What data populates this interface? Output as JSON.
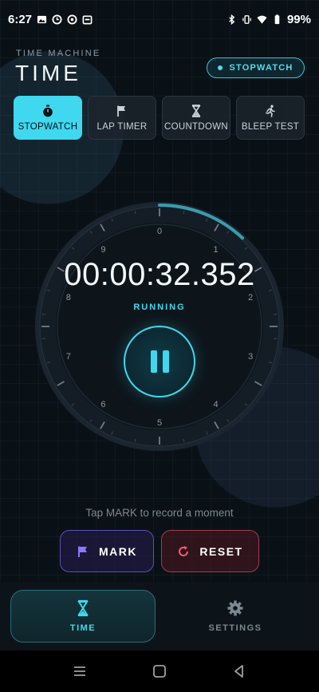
{
  "status_bar": {
    "time": "6:27",
    "battery": "99%"
  },
  "header": {
    "app_name": "TIME MACHINE",
    "title": "TIME",
    "mode_pill": "STOPWATCH"
  },
  "tabs": [
    {
      "label": "STOPWATCH",
      "icon": "stopwatch-icon",
      "active": true
    },
    {
      "label": "LAP TIMER",
      "icon": "flag-icon",
      "active": false
    },
    {
      "label": "COUNTDOWN",
      "icon": "hourglass-icon",
      "active": false
    },
    {
      "label": "BLEEP TEST",
      "icon": "runner-icon",
      "active": false
    }
  ],
  "dial": {
    "numbers": [
      "0",
      "1",
      "2",
      "3",
      "4",
      "5",
      "6",
      "7",
      "8",
      "9"
    ],
    "progress_fraction": 0.12
  },
  "timer": {
    "display": "00:00:32.352",
    "state": "RUNNING",
    "control": "pause"
  },
  "hint": "Tap MARK to record a moment",
  "actions": {
    "mark": "MARK",
    "reset": "RESET"
  },
  "bottom_nav": [
    {
      "label": "TIME",
      "icon": "hourglass-icon",
      "active": true
    },
    {
      "label": "SETTINGS",
      "icon": "gear-icon",
      "active": false
    }
  ],
  "colors": {
    "accent": "#3fd8ef",
    "mark": "#8a78ff",
    "reset": "#ff5a6e",
    "background": "#0a1116"
  }
}
